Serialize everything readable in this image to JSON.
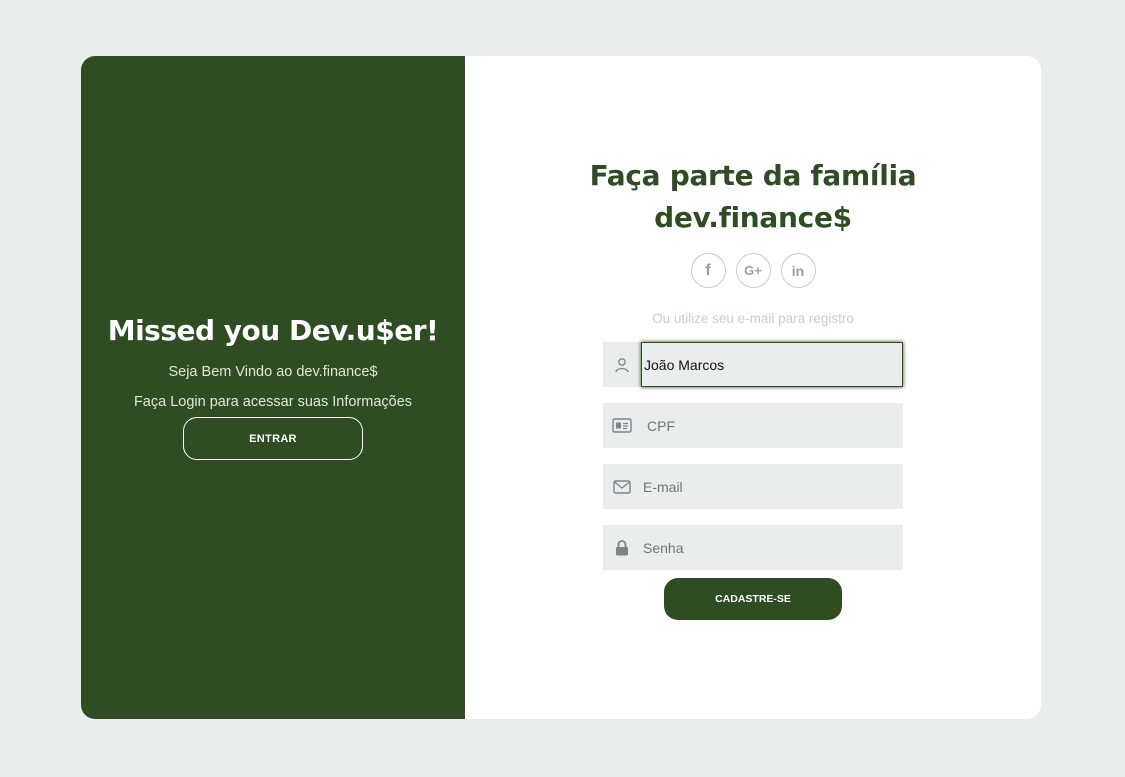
{
  "welcome_panel": {
    "title": "Missed you Dev.u$er!",
    "subtitle": "Seja Bem Vindo ao dev.finance$",
    "description": "Faça Login para acessar suas Informações",
    "login_button": "ENTRAR"
  },
  "signup": {
    "title_line1": "Faça parte da família",
    "title_line2": "dev.finance$",
    "social": [
      {
        "icon": "facebook-icon",
        "glyph": "f"
      },
      {
        "icon": "google-plus-icon",
        "glyph": "G+"
      },
      {
        "icon": "linkedin-icon",
        "glyph": "in"
      }
    ],
    "hint": "Ou utilize seu e-mail para registro",
    "fields": {
      "name_value": "João Marcos",
      "cpf_placeholder": "CPF",
      "email_placeholder": "E-mail",
      "password_placeholder": "Senha"
    },
    "submit_button": "CADASTRE-SE"
  },
  "colors": {
    "brand": "#2f4c23",
    "background": "#e9edee",
    "input_bg": "#e9edee"
  }
}
